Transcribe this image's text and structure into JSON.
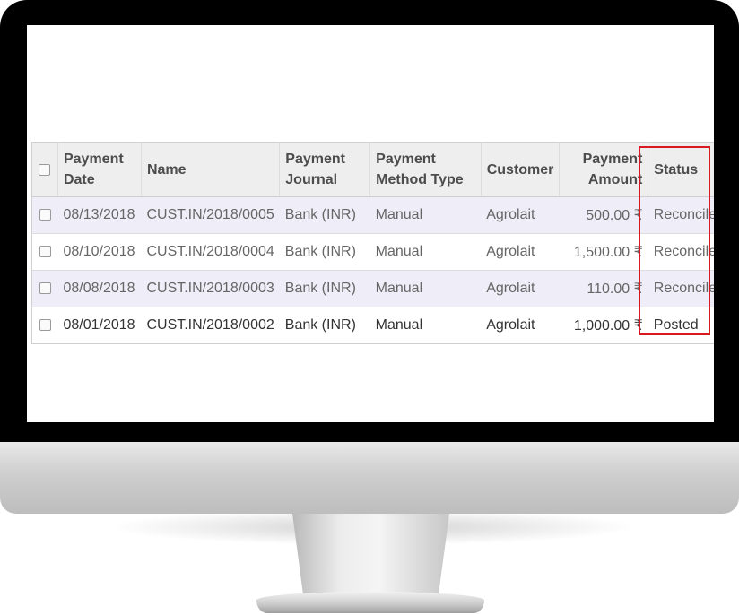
{
  "table": {
    "headers": {
      "payment_date": [
        "Payment",
        "Date"
      ],
      "name": "Name",
      "payment_journal": [
        "Payment",
        "Journal"
      ],
      "payment_method_type": [
        "Payment",
        "Method Type"
      ],
      "customer": "Customer",
      "payment_amount": [
        "Payment",
        "Amount"
      ],
      "status": "Status"
    },
    "rows": [
      {
        "date": "08/13/2018",
        "name": "CUST.IN/2018/0005",
        "journal": "Bank (INR)",
        "method": "Manual",
        "customer": "Agrolait",
        "amount": "500.00 ₹",
        "status": "Reconciled"
      },
      {
        "date": "08/10/2018",
        "name": "CUST.IN/2018/0004",
        "journal": "Bank (INR)",
        "method": "Manual",
        "customer": "Agrolait",
        "amount": "1,500.00 ₹",
        "status": "Reconciled"
      },
      {
        "date": "08/08/2018",
        "name": "CUST.IN/2018/0003",
        "journal": "Bank (INR)",
        "method": "Manual",
        "customer": "Agrolait",
        "amount": "110.00 ₹",
        "status": "Reconciled"
      },
      {
        "date": "08/01/2018",
        "name": "CUST.IN/2018/0002",
        "journal": "Bank (INR)",
        "method": "Manual",
        "customer": "Agrolait",
        "amount": "1,000.00 ₹",
        "status": "Posted"
      }
    ]
  },
  "colors": {
    "highlight_border": "#d9191f",
    "row_stripe": "#efeef8",
    "header_bg": "#eeeeee"
  }
}
